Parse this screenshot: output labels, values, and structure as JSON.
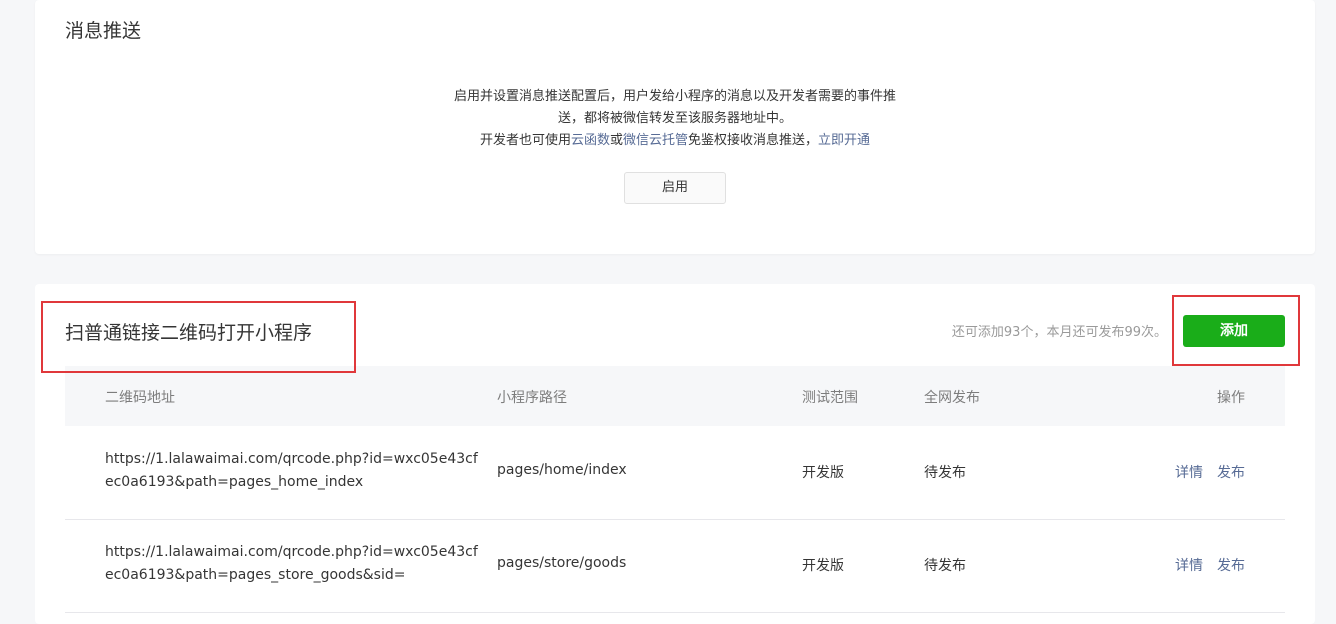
{
  "push_section": {
    "title": "消息推送",
    "desc_line1": "启用并设置消息推送配置后，用户发给小程序的消息以及开发者需要的事件推",
    "desc_line2": "送，都将被微信转发至该服务器地址中。",
    "desc_line3_prefix": "开发者也可使用",
    "link_cloud_func": "云函数",
    "desc_or": "或",
    "link_cloud_host": "微信云托管",
    "desc_line3_suffix": "免鉴权接收消息推送，",
    "link_open_now": "立即开通",
    "enable_button": "启用"
  },
  "qr_section": {
    "title": "扫普通链接二维码打开小程序",
    "quota_text": "还可添加93个，本月还可发布99次。",
    "add_button": "添加",
    "columns": {
      "qr_url": "二维码地址",
      "path": "小程序路径",
      "scope": "测试范围",
      "publish": "全网发布",
      "actions": "操作"
    },
    "rows": [
      {
        "url": "https://1.lalawaimai.com/qrcode.php?id=wxc05e43cfec0a6193&path=pages_home_index",
        "path": "pages/home/index",
        "scope": "开发版",
        "publish": "待发布",
        "detail": "详情",
        "release": "发布"
      },
      {
        "url": "https://1.lalawaimai.com/qrcode.php?id=wxc05e43cfec0a6193&path=pages_store_goods&sid=",
        "path": "pages/store/goods",
        "scope": "开发版",
        "publish": "待发布",
        "detail": "详情",
        "release": "发布"
      }
    ]
  },
  "colors": {
    "primary_green": "#1aad19",
    "link_blue": "#576b95",
    "highlight_red": "#e0383b"
  }
}
